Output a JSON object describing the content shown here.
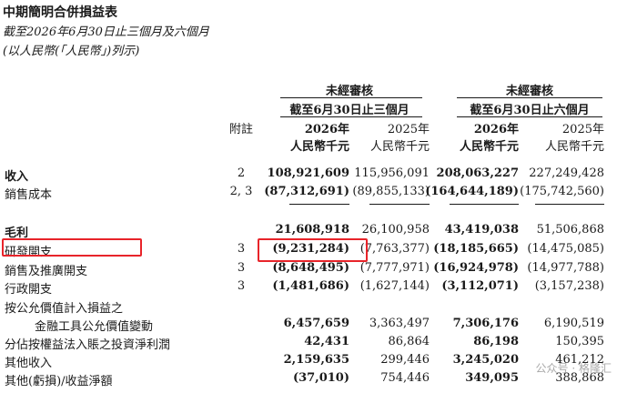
{
  "title": "中期簡明合併損益表",
  "subtitle1": "截至2026年6月30日止三個月及六個月",
  "subtitle2": "(以人民幣(「人民幣」)列示)",
  "header": {
    "group_label": "未經審核",
    "period_3m": "截至6月30日止三個月",
    "period_6m": "截至6月30日止六個月",
    "note_label": "附註",
    "year_2026": "2026年",
    "year_2025": "2025年",
    "unit": "人民幣千元"
  },
  "rows": [
    {
      "label": "收入",
      "note": "2",
      "q2026": "108,921,609",
      "q2025": "115,956,091",
      "h2026": "208,063,227",
      "h2025": "227,249,428"
    },
    {
      "label": "銷售成本",
      "note": "2, 3",
      "q2026": "(87,312,691)",
      "q2025": "(89,855,133)",
      "h2026": "(164,644,189)",
      "h2025": "(175,742,560)"
    },
    {
      "label": "毛利",
      "note": "",
      "q2026": "21,608,918",
      "q2025": "26,100,958",
      "h2026": "43,419,038",
      "h2025": "51,506,868"
    },
    {
      "label": "研發開支",
      "note": "3",
      "q2026": "(9,231,284)",
      "q2025": "(7,763,377)",
      "h2026": "(18,185,665)",
      "h2025": "(14,475,085)"
    },
    {
      "label": "銷售及推廣開支",
      "note": "3",
      "q2026": "(8,648,495)",
      "q2025": "(7,777,971)",
      "h2026": "(16,924,978)",
      "h2025": "(14,977,788)"
    },
    {
      "label": "行政開支",
      "note": "3",
      "q2026": "(1,481,686)",
      "q2025": "(1,627,144)",
      "h2026": "(3,112,071)",
      "h2025": "(3,157,238)"
    },
    {
      "label": "按公允價值計入損益之",
      "note": "",
      "q2026": "",
      "q2025": "",
      "h2026": "",
      "h2025": ""
    },
    {
      "label": "金融工具公允價值變動",
      "note": "",
      "q2026": "6,457,659",
      "q2025": "3,363,497",
      "h2026": "7,306,176",
      "h2025": "6,190,519"
    },
    {
      "label": "分佔按權益法入賬之投資淨利潤",
      "note": "",
      "q2026": "42,431",
      "q2025": "86,864",
      "h2026": "86,198",
      "h2025": "150,395"
    },
    {
      "label": "其他收入",
      "note": "",
      "q2026": "2,159,635",
      "q2025": "299,446",
      "h2026": "3,245,020",
      "h2025": "461,212"
    },
    {
      "label": "其他(虧損)/收益淨額",
      "note": "",
      "q2026": "(37,010)",
      "q2025": "754,446",
      "h2026": "349,095",
      "h2025": "388,868"
    }
  ],
  "watermark": "公众号 · 格隆汇",
  "highlight_color": "#e8242a"
}
